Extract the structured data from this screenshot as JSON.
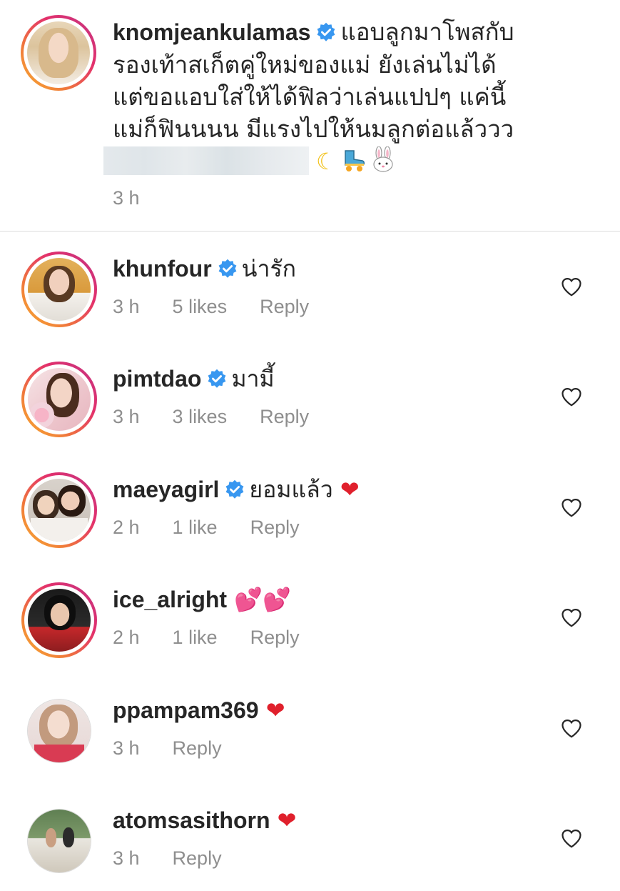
{
  "caption": {
    "username": "knomjeankulamas",
    "verified": true,
    "text_lines": [
      "แอบลูกมาโพสกับ",
      "รองเท้าสเก็ตคู่ใหม่ของแม่ ยังเล่นไม่ได้",
      "แต่ขอแอบใส่ให้ได้ฟิลว่าเล่นแปปๆ แค่นี้",
      "แม่ก็ฟินนนน มีแรงไปให้นมลูกต่อแล้ววว"
    ],
    "emojis": [
      "crescent-moon",
      "roller-skate",
      "rabbit-face"
    ],
    "time": "3 h"
  },
  "comments": [
    {
      "username": "khunfour",
      "verified": true,
      "text": "น่ารัก",
      "emoji": "",
      "time": "3 h",
      "likes": "5 likes",
      "reply": "Reply"
    },
    {
      "username": "pimtdao",
      "verified": true,
      "text": "มามี้",
      "emoji": "",
      "time": "3 h",
      "likes": "3 likes",
      "reply": "Reply"
    },
    {
      "username": "maeyagirl",
      "verified": true,
      "text": "ยอมแล้ว",
      "emoji": "❤",
      "time": "2 h",
      "likes": "1 like",
      "reply": "Reply"
    },
    {
      "username": "ice_alright",
      "verified": false,
      "text": "",
      "emoji": "💕💕",
      "time": "2 h",
      "likes": "1 like",
      "reply": "Reply"
    },
    {
      "username": "ppampam369",
      "verified": false,
      "text": "",
      "emoji": "❤",
      "time": "3 h",
      "likes": "",
      "reply": "Reply"
    },
    {
      "username": "atomsasithorn",
      "verified": false,
      "text": "",
      "emoji": "❤",
      "time": "3 h",
      "likes": "",
      "reply": "Reply"
    }
  ],
  "colors": {
    "verified_blue": "#3897f0",
    "muted": "#8e8e8e",
    "heart_red": "#e0202c"
  }
}
